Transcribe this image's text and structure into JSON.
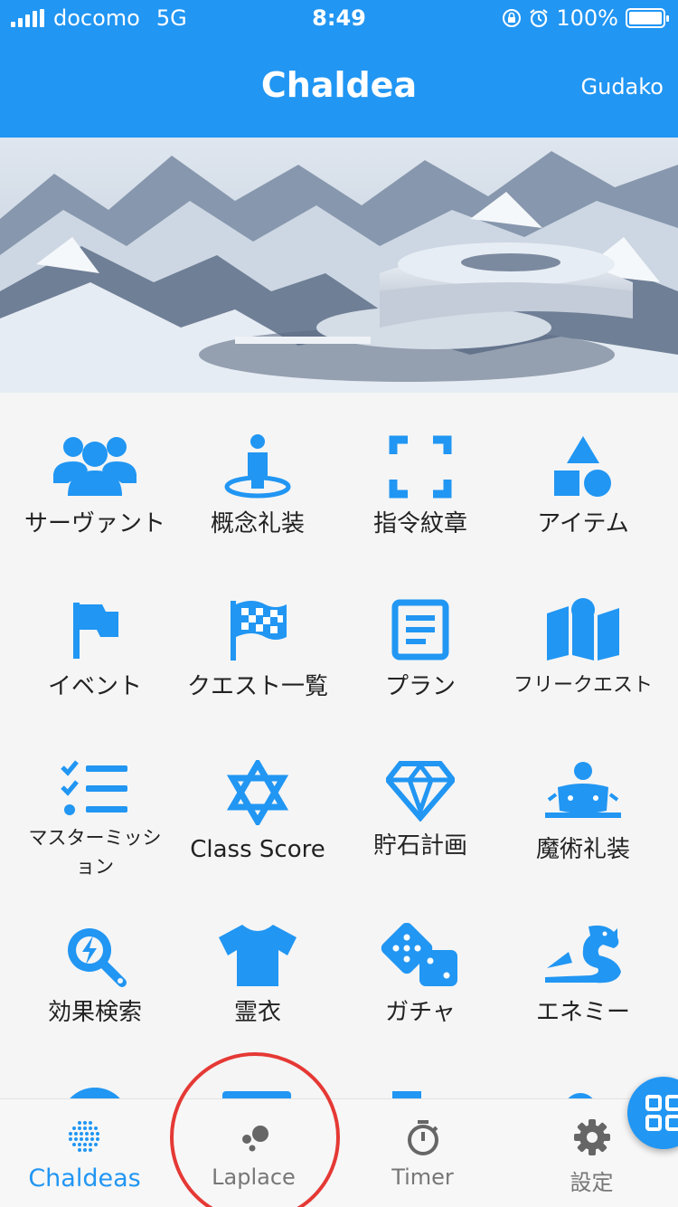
{
  "status_bar": {
    "carrier": "docomo",
    "network": "5G",
    "time": "8:49",
    "battery": "100%",
    "battery_level": 1.0
  },
  "app_bar": {
    "title": "Chaldea",
    "account": "Gudako",
    "color": "#2196f3"
  },
  "banner": {
    "icon": "chaldea-mountain-facility-image"
  },
  "grid": {
    "items": [
      {
        "label": "サーヴァント",
        "icon": "servant-people-icon"
      },
      {
        "label": "概念礼装",
        "icon": "craft-essence-person-icon"
      },
      {
        "label": "指令紋章",
        "icon": "command-code-frame-icon"
      },
      {
        "label": "アイテム",
        "icon": "item-shapes-icon"
      },
      {
        "label": "イベント",
        "icon": "event-flag-icon"
      },
      {
        "label": "クエスト一覧",
        "icon": "quest-checkered-flag-icon"
      },
      {
        "label": "プラン",
        "icon": "plan-document-icon"
      },
      {
        "label": "フリークエスト",
        "icon": "free-quest-map-icon"
      },
      {
        "label": "マスターミッション",
        "icon": "master-mission-checklist-icon"
      },
      {
        "label": "Class Score",
        "icon": "class-score-star-icon"
      },
      {
        "label": "貯石計画",
        "icon": "saint-quartz-diamond-icon"
      },
      {
        "label": "魔術礼装",
        "icon": "mystic-code-icon"
      },
      {
        "label": "効果検索",
        "icon": "effect-search-icon"
      },
      {
        "label": "霊衣",
        "icon": "costume-shirt-icon"
      },
      {
        "label": "ガチャ",
        "icon": "gacha-dice-icon"
      },
      {
        "label": "エネミー",
        "icon": "enemy-dragon-icon"
      }
    ]
  },
  "bottom_nav": {
    "items": [
      {
        "label": "Chaldeas",
        "icon": "chaldeas-globe-icon",
        "active": true
      },
      {
        "label": "Laplace",
        "icon": "laplace-bubbles-icon",
        "active": false
      },
      {
        "label": "Timer",
        "icon": "timer-stopwatch-icon",
        "active": false
      },
      {
        "label": "設定",
        "icon": "settings-gear-icon",
        "active": false
      }
    ]
  },
  "fab": {
    "icon": "grid-apps-icon"
  },
  "colors": {
    "accent": "#2196f3",
    "highlight": "#e53935",
    "inactive": "#777777"
  }
}
